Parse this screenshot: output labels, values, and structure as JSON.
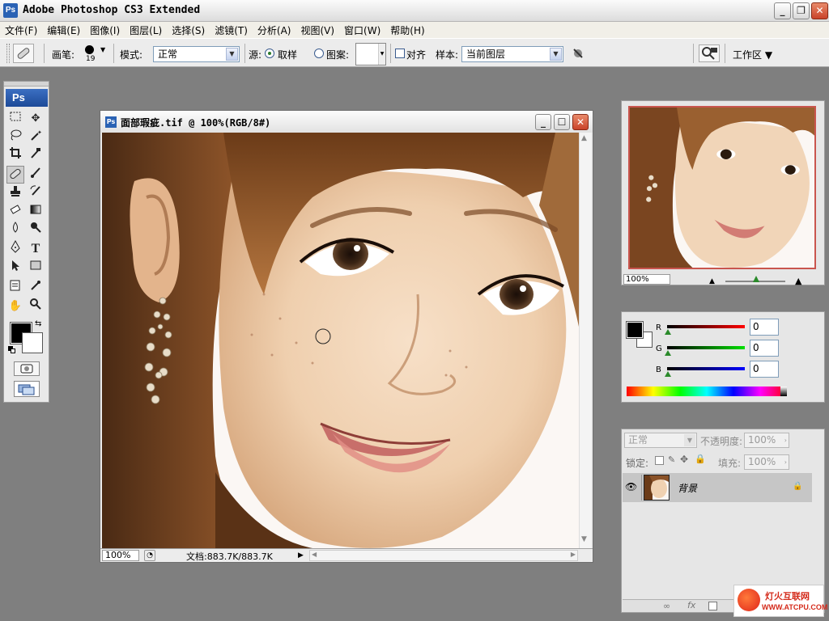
{
  "app": {
    "title": "Adobe Photoshop CS3 Extended",
    "icon_text": "Ps"
  },
  "window_controls": {
    "minimize": "_",
    "restore": "❐",
    "close": "✕"
  },
  "menu": [
    "文件(F)",
    "编辑(E)",
    "图像(I)",
    "图层(L)",
    "选择(S)",
    "滤镜(T)",
    "分析(A)",
    "视图(V)",
    "窗口(W)",
    "帮助(H)"
  ],
  "options": {
    "brush_label": "画笔:",
    "brush_size": "19",
    "mode_label": "模式:",
    "mode_value": "正常",
    "source_label": "源:",
    "sampled_label": "取样",
    "pattern_label": "图案:",
    "aligned_label": "对齐",
    "sample_label": "样本:",
    "sample_value": "当前图层",
    "workspace_label": "工作区 ▼"
  },
  "toolbox": {
    "logo": "Ps"
  },
  "document": {
    "title": "面部瑕疵.tif @ 100%(RGB/8#)",
    "zoom": "100%",
    "doc_info": "文档:883.7K/883.7K"
  },
  "navigator": {
    "zoom": "100%"
  },
  "color": {
    "r_label": "R",
    "g_label": "G",
    "b_label": "B",
    "r_value": "0",
    "g_value": "0",
    "b_value": "0",
    "foreground": "#000000",
    "background": "#ffffff"
  },
  "layers": {
    "blend_mode": "正常",
    "opacity_label": "不透明度:",
    "opacity_value": "100%",
    "lock_label": "锁定:",
    "fill_label": "填充:",
    "fill_value": "100%",
    "layer_name": "背景"
  },
  "watermark": {
    "name": "灯火互联网",
    "url": "WWW.ATCPU.COM"
  }
}
